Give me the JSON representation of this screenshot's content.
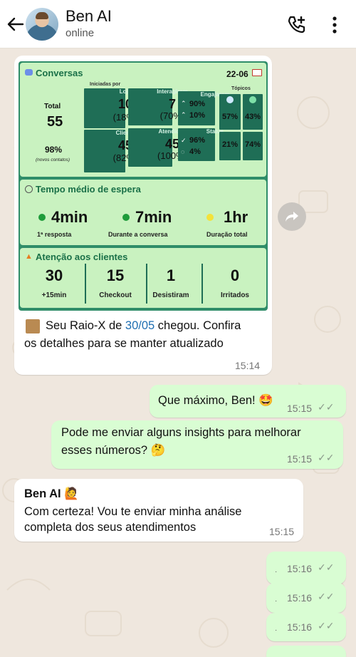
{
  "header": {
    "name": "Ben AI",
    "status": "online"
  },
  "card": {
    "conversas_title": "Conversas",
    "date": "22-06",
    "iniciadas_por": "Iniciadas por",
    "total_label": "Total",
    "total_value": "55",
    "novos_pct": "98%",
    "novos_label": "(novos contatos)",
    "loja_label": "Loja",
    "loja_value": "10",
    "loja_pct": "(18%)",
    "cliente_label": "Cliente",
    "cliente_value": "45",
    "cliente_pct": "(82%)",
    "interagiram_label": "Interagiram",
    "interagiram_value": "7",
    "interagiram_pct": "(70%)",
    "atendidos_label": "Atendidos",
    "atendidos_value": "45",
    "atendidos_pct": "(100%)",
    "engajaram_label": "Engajaram",
    "engajaram_up": "90%",
    "engajaram_down": "10%",
    "status_label": "Status",
    "status_done": "96%",
    "status_pending": "4%",
    "topicos_label": "Tópicos",
    "topicos_a1": "57%",
    "topicos_b1": "43%",
    "topicos_a2": "21%",
    "topicos_b2": "74%",
    "espera_title": "Tempo médio de espera",
    "resp_value": "4min",
    "resp_label": "1ª resposta",
    "durante_value": "7min",
    "durante_label": "Durante a conversa",
    "duracao_value": "1hr",
    "duracao_label": "Duração total",
    "atencao_title": "Atenção aos clientes",
    "att1_value": "30",
    "att1_label": "+15min",
    "att2_value": "15",
    "att2_label": "Checkout",
    "att3_value": "1",
    "att3_label": "Desistiram",
    "att4_value": "0",
    "att4_label": "Irritados"
  },
  "messages": {
    "m1_pre": "Seu Raio-X de ",
    "m1_link": "30/05",
    "m1_post": " chegou. Confira",
    "m1_line2": "os detalhes para se manter atualizado",
    "m1_time": "15:14",
    "m2_text": "Que máximo, Ben! 🤩",
    "m2_time": "15:15",
    "m3_line1": "Pode me enviar alguns insights para melhorar",
    "m3_line2": "esses números? 🤔",
    "m3_time": "15:15",
    "m4_sender": "Ben AI 🙋",
    "m4_line1": "Com certeza! Vou te enviar minha análise",
    "m4_line2": "completa dos seus atendimentos",
    "m4_time": "15:15",
    "m5_time": "15:16",
    "m6_time": "15:16",
    "m7_time": "15:16"
  },
  "colors": {
    "outgoing_bubble": "#d9fdd3",
    "incoming_bubble": "#ffffff",
    "card_dark": "#1f6e56",
    "card_light": "#c9f2c0",
    "link": "#1f6fb2"
  }
}
